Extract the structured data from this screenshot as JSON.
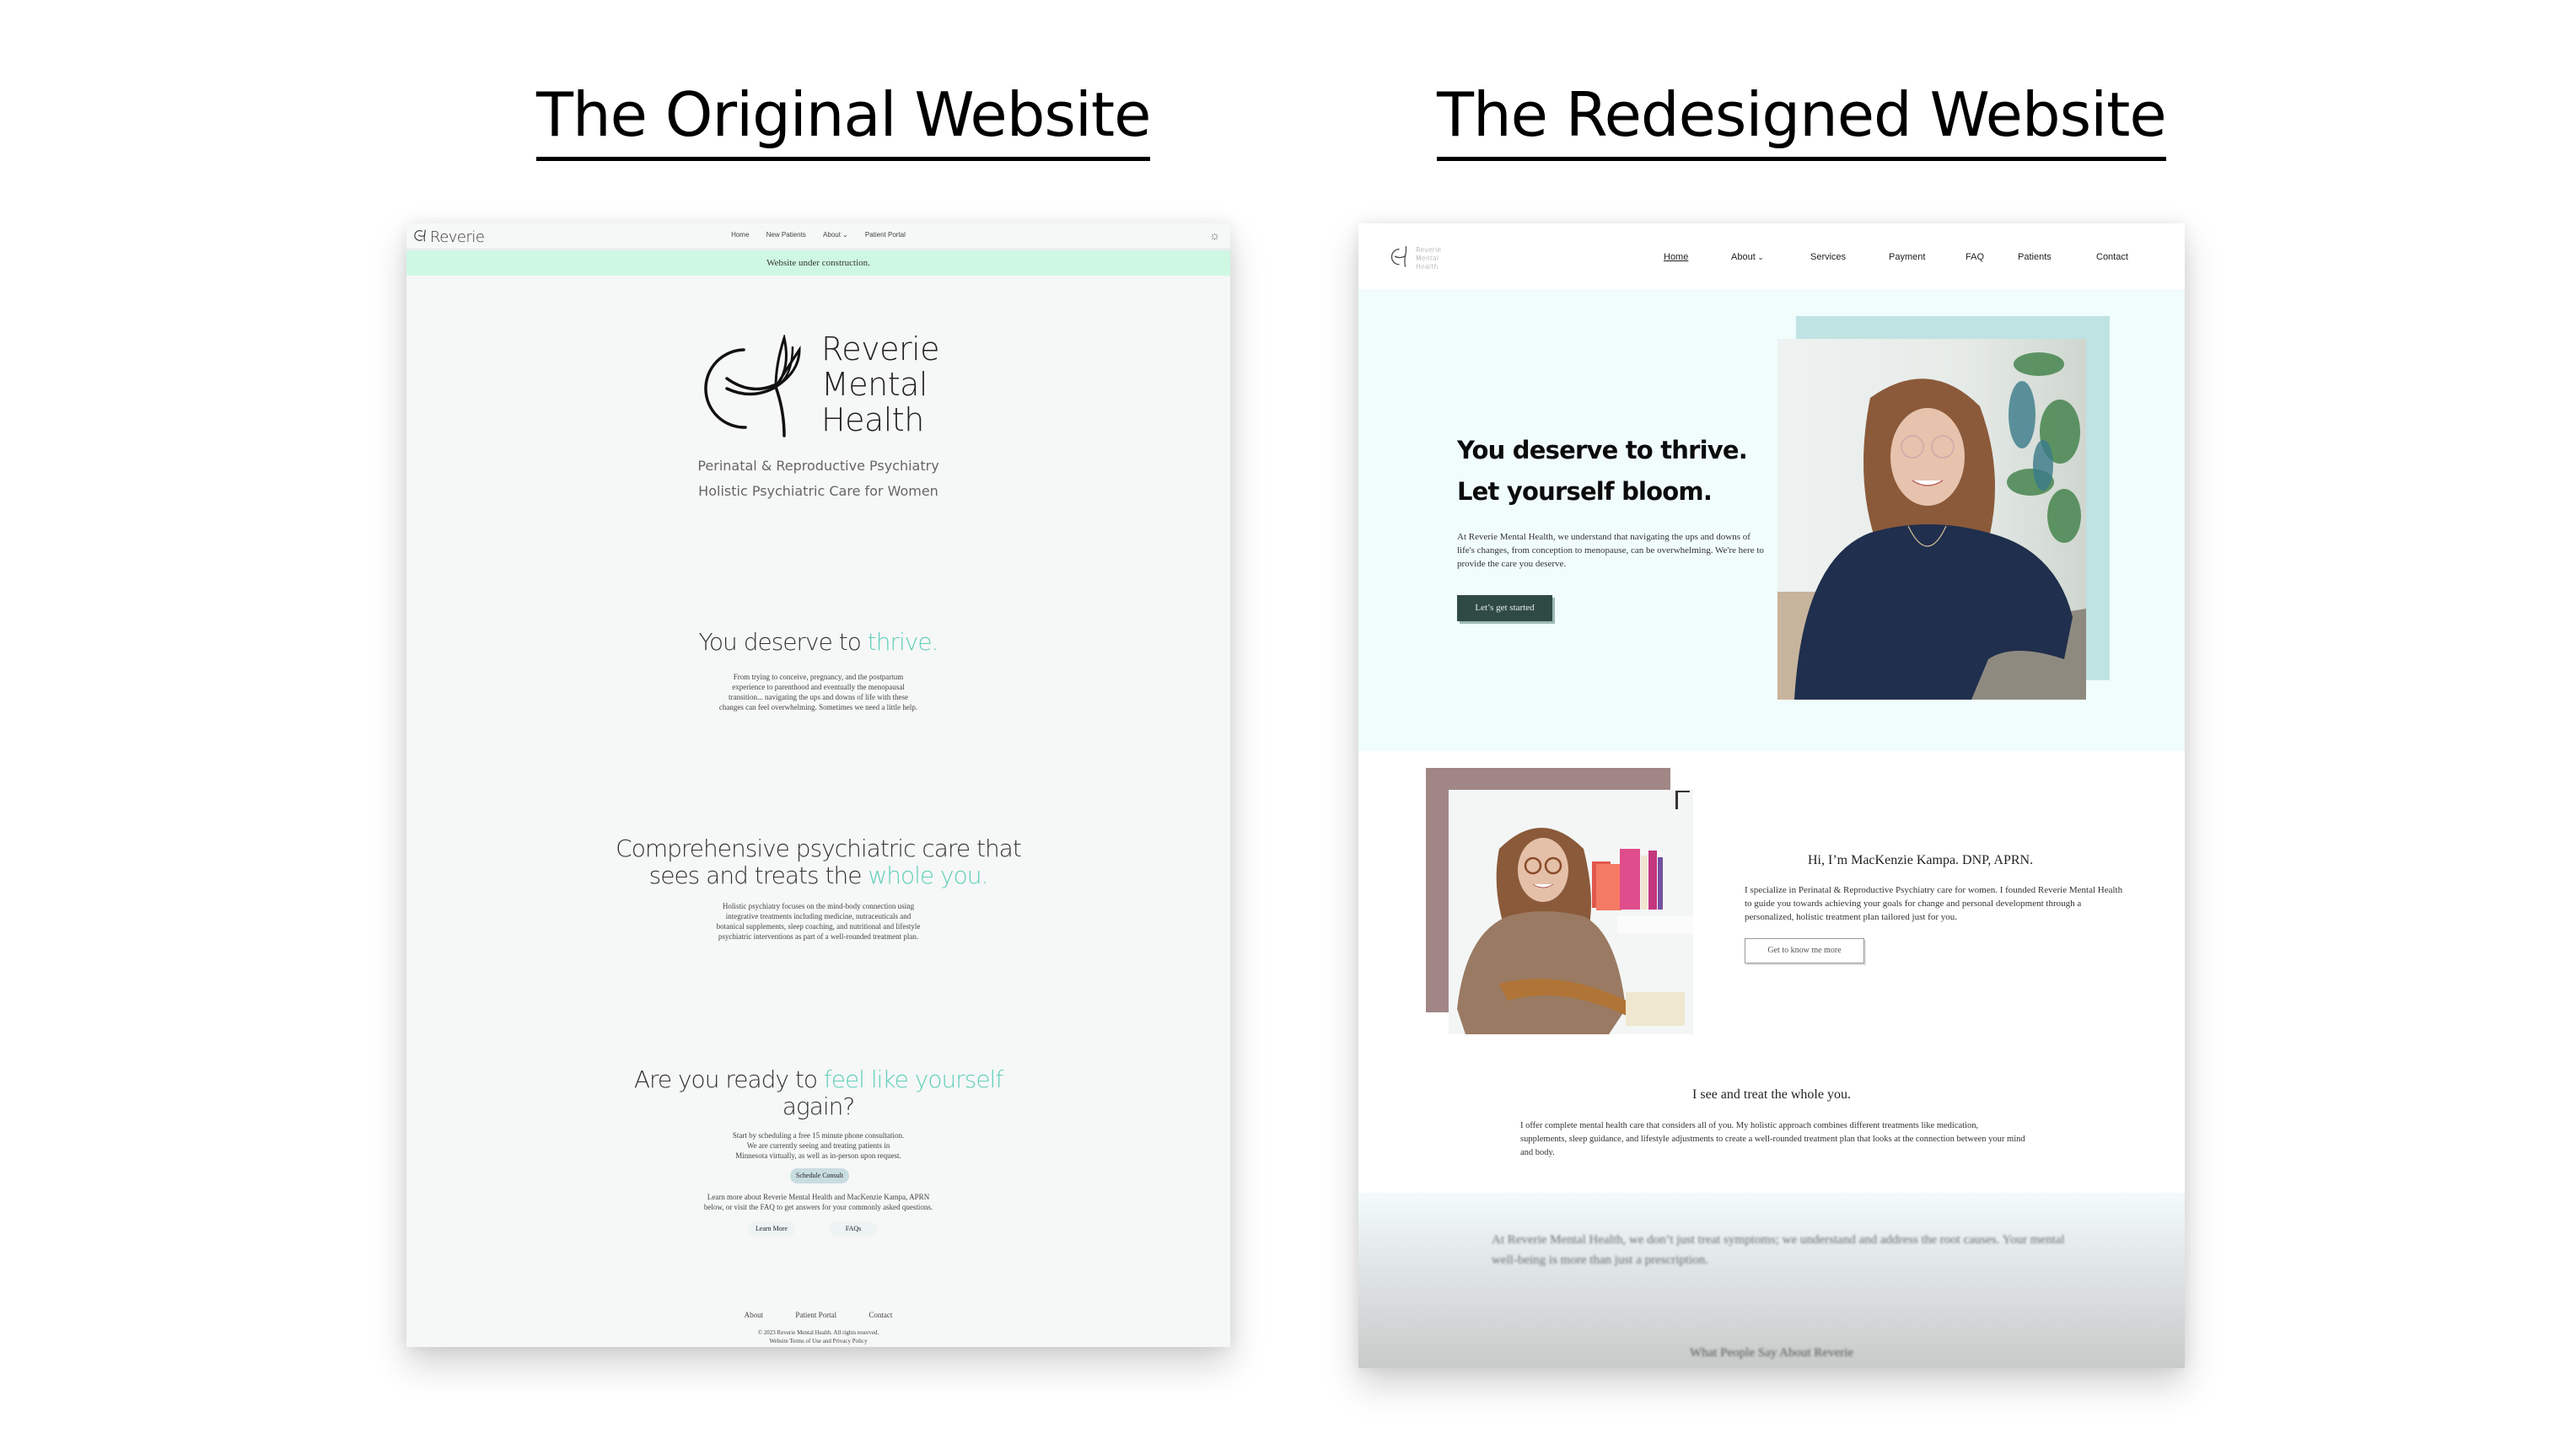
{
  "headings": {
    "original": "The Original Website",
    "redesigned": "The Redesigned Website"
  },
  "original": {
    "nav": {
      "logo": "Reverie",
      "links": [
        "Home",
        "New Patients",
        "About",
        "Patient Portal"
      ],
      "about_has_dropdown": true,
      "theme_icon": "sun-icon"
    },
    "banner": "Website under construction.",
    "brand": {
      "line1": "Reverie",
      "line2": "Mental",
      "line3": "Health",
      "tagline1": "Perinatal & Reproductive Psychiatry",
      "tagline2": "Holistic Psychiatric Care for Women"
    },
    "section1": {
      "title_plain": "You deserve to ",
      "title_accent": "thrive.",
      "body": [
        "From trying to conceive, pregnancy, and the postpartum",
        "experience to parenthood and eventually the menopausal",
        "transition... navigating the ups and downs of life with these",
        "changes can feel overwhelming. Sometimes we need a little help."
      ]
    },
    "section2": {
      "title_line1": "Comprehensive psychiatric care that",
      "title_line2_plain": "sees and treats the ",
      "title_line2_accent": "whole you.",
      "body": [
        "Holistic psychiatry focuses on the mind-body connection using",
        "integrative treatments including medicine, nutraceuticals and",
        "botanical supplements, sleep coaching, and nutritional and lifestyle",
        "psychiatric interventions as part of a well-rounded treatment plan."
      ]
    },
    "section3": {
      "title_plain": "Are you ready to ",
      "title_accent": "feel like yourself",
      "title_line2": "again?",
      "body": [
        "Start by scheduling a free 15 minute phone consultation.",
        "We are currently seeing and treating patients in",
        "Minnesota virtually, as well as in-person upon request."
      ],
      "schedule_button": "Schedule Consult",
      "more": [
        "Learn more about Reverie Mental Health and MacKenzie Kampa, APRN",
        "below, or visit the FAQ to get answers for your commonly asked questions."
      ],
      "learn_more_button": "Learn More",
      "faqs_button": "FAQs"
    },
    "footer": {
      "links": [
        "About",
        "Patient Portal",
        "Contact"
      ],
      "copyright": "© 2023 Reverie Mental Health. All rights reserved.",
      "legal": "Website Terms of Use and Privacy Policy"
    },
    "colors": {
      "accent": "#5fcfb8",
      "banner_bg": "#cff8e4",
      "page_bg": "#f6f7f7",
      "schedule_button_bg": "#c9dde0"
    }
  },
  "redesigned": {
    "nav": {
      "logo_lines": [
        "Reverie",
        "Mental",
        "Health"
      ],
      "links": [
        "Home",
        "About",
        "Services",
        "Payment",
        "FAQ",
        "Patients",
        "Contact"
      ],
      "active": "Home",
      "about_has_dropdown": true
    },
    "hero": {
      "title_line1": "You deserve to thrive.",
      "title_line2": "Let yourself bloom.",
      "body": "At Reverie Mental Health, we understand that navigating the ups and downs of life's changes, from conception to menopause, can be overwhelming. We're here to provide the care you deserve.",
      "cta": "Let’s get started",
      "photo_alt": "Portrait of woman in navy sweater with glasses"
    },
    "intro": {
      "title": "Hi, I’m MacKenzie Kampa. DNP, APRN.",
      "body": "I specialize in Perinatal & Reproductive Psychiatry care for women. I founded Reverie Mental Health to guide you towards achieving your goals for change and personal development through a personalized, holistic treatment plan tailored just for you.",
      "button": "Get to know me more",
      "photo_alt": "Portrait of woman in brown top sitting in chair"
    },
    "whole": {
      "title": "I see and treat the whole you.",
      "body": "I offer complete mental health care that considers all of you. My holistic approach combines different treatments like medication, supplements, sleep guidance, and lifestyle adjustments to create a well-rounded treatment plan that looks at the connection between your mind and body."
    },
    "statement": "At Reverie Mental Health, we don’t just treat symptoms; we understand and address the root causes. Your mental well-being is more than just a prescription.",
    "testimonials_title": "What People Say About Reverie",
    "colors": {
      "hero_bg": "#f1fdfd",
      "cta_bg": "#2f4a44",
      "photo1_frame": "#bfe3e3",
      "photo2_frame": "#a18686"
    }
  }
}
